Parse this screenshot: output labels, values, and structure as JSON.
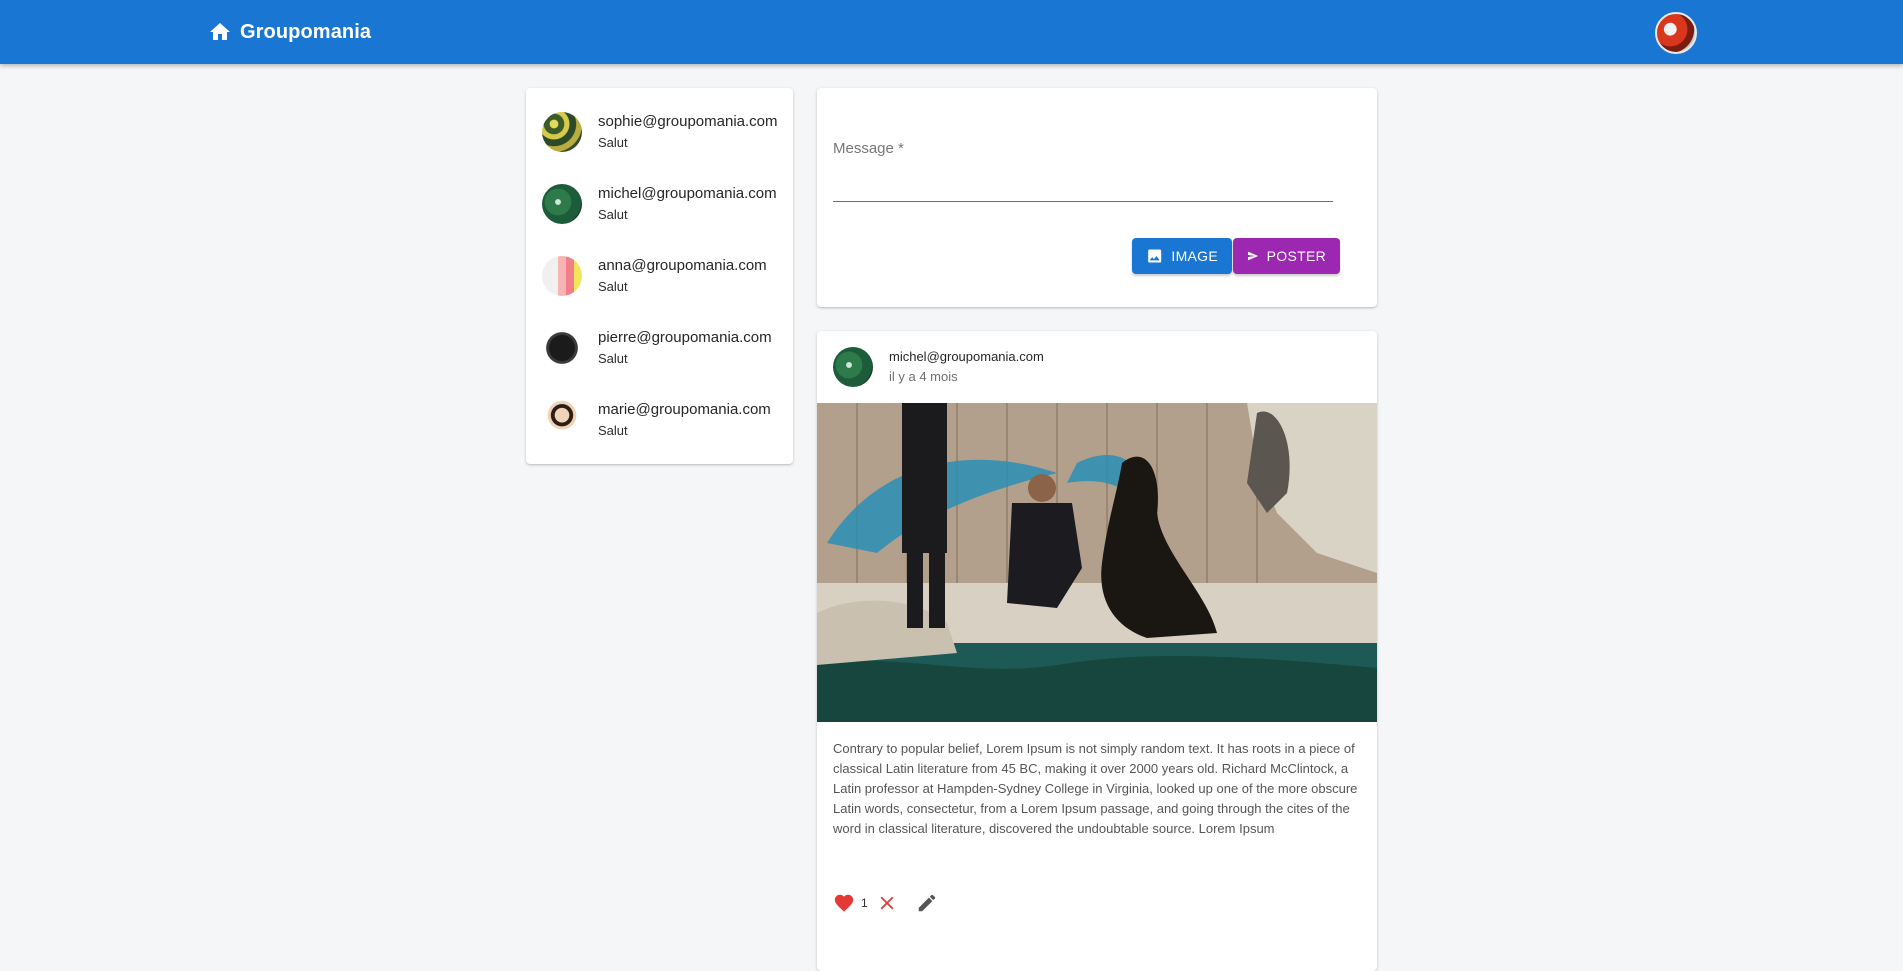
{
  "header": {
    "title": "Groupomania",
    "home_icon": "home-icon",
    "bar_color": "#1976d2"
  },
  "users": [
    {
      "email": "sophie@groupomania.com",
      "status": "Salut"
    },
    {
      "email": "michel@groupomania.com",
      "status": "Salut"
    },
    {
      "email": "anna@groupomania.com",
      "status": "Salut"
    },
    {
      "email": "pierre@groupomania.com",
      "status": "Salut"
    },
    {
      "email": "marie@groupomania.com",
      "status": "Salut"
    }
  ],
  "composer": {
    "message_label": "Message *",
    "message_value": "",
    "image_button": "IMAGE",
    "post_button": "POSTER",
    "image_button_color": "#1976d2",
    "post_button_color": "#9c27b0"
  },
  "post": {
    "author": "michel@groupomania.com",
    "time": "il y a 4 mois",
    "body": "Contrary to popular belief, Lorem Ipsum is not simply random text. It has roots in a piece of classical Latin literature from 45 BC, making it over 2000 years old. Richard McClintock, a Latin professor at Hampden-Sydney College in Virginia, looked up one of the more obscure Latin words, consectetur, from a Lorem Ipsum passage, and going through the cites of the word in classical literature, discovered the undoubtable source. Lorem Ipsum",
    "likes": "1",
    "like_color": "#e53935"
  }
}
